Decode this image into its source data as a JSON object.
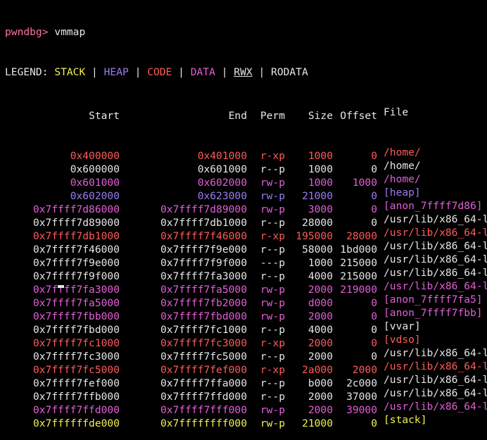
{
  "colors": {
    "prompt": "#ff6fa3",
    "default": "#e6e6e6",
    "stack": "#f0f050",
    "heap": "#9a7cf2",
    "code": "#ff5a5a",
    "data": "#e35fd7",
    "rodata": "#e6e6e6"
  },
  "prompt": {
    "label": "pwndbg>",
    "command": "vmmap"
  },
  "legend": {
    "prefix": "LEGEND:",
    "items": [
      {
        "label": "STACK",
        "kind": "stack",
        "underline": false
      },
      {
        "label": "HEAP",
        "kind": "heap",
        "underline": false
      },
      {
        "label": "CODE",
        "kind": "code",
        "underline": false
      },
      {
        "label": "DATA",
        "kind": "data",
        "underline": false
      },
      {
        "label": "RWX",
        "kind": "rodata",
        "underline": true
      },
      {
        "label": "RODATA",
        "kind": "rodata",
        "underline": false
      }
    ],
    "separator": "|"
  },
  "table": {
    "headers": {
      "start": "Start",
      "end": "End",
      "perm": "Perm",
      "size": "Size",
      "offset": "Offset",
      "file": "File"
    },
    "rows": [
      {
        "start": "0x400000",
        "end": "0x401000",
        "perm": "r-xp",
        "size": "1000",
        "offset": "0",
        "file": "/home/",
        "kind": "code"
      },
      {
        "start": "0x600000",
        "end": "0x601000",
        "perm": "r--p",
        "size": "1000",
        "offset": "0",
        "file": "/home/",
        "kind": "rodata"
      },
      {
        "start": "0x601000",
        "end": "0x602000",
        "perm": "rw-p",
        "size": "1000",
        "offset": "1000",
        "file": "/home/",
        "kind": "data"
      },
      {
        "start": "0x602000",
        "end": "0x623000",
        "perm": "rw-p",
        "size": "21000",
        "offset": "0",
        "file": "[heap]",
        "kind": "heap"
      },
      {
        "start": "0x7ffff7d86000",
        "end": "0x7ffff7d89000",
        "perm": "rw-p",
        "size": "3000",
        "offset": "0",
        "file": "[anon_7ffff7d86]",
        "kind": "data"
      },
      {
        "start": "0x7ffff7d89000",
        "end": "0x7ffff7db1000",
        "perm": "r--p",
        "size": "28000",
        "offset": "0",
        "file": "/usr/lib/x86_64-l",
        "kind": "rodata"
      },
      {
        "start": "0x7ffff7db1000",
        "end": "0x7ffff7f46000",
        "perm": "r-xp",
        "size": "195000",
        "offset": "28000",
        "file": "/usr/lib/x86_64-l",
        "kind": "code"
      },
      {
        "start": "0x7ffff7f46000",
        "end": "0x7ffff7f9e000",
        "perm": "r--p",
        "size": "58000",
        "offset": "1bd000",
        "file": "/usr/lib/x86_64-l",
        "kind": "rodata"
      },
      {
        "start": "0x7ffff7f9e000",
        "end": "0x7ffff7f9f000",
        "perm": "---p",
        "size": "1000",
        "offset": "215000",
        "file": "/usr/lib/x86_64-l",
        "kind": "rodata"
      },
      {
        "start": "0x7ffff7f9f000",
        "end": "0x7ffff7fa3000",
        "perm": "r--p",
        "size": "4000",
        "offset": "215000",
        "file": "/usr/lib/x86_64-l",
        "kind": "rodata"
      },
      {
        "start": "0x7ffff7fa3000",
        "end": "0x7ffff7fa5000",
        "perm": "rw-p",
        "size": "2000",
        "offset": "219000",
        "file": "/usr/lib/x86_64-l",
        "kind": "data"
      },
      {
        "start": "0x7ffff7fa5000",
        "end": "0x7ffff7fb2000",
        "perm": "rw-p",
        "size": "d000",
        "offset": "0",
        "file": "[anon_7ffff7fa5]",
        "kind": "data"
      },
      {
        "start": "0x7ffff7fbb000",
        "end": "0x7ffff7fbd000",
        "perm": "rw-p",
        "size": "2000",
        "offset": "0",
        "file": "[anon_7ffff7fbb]",
        "kind": "data"
      },
      {
        "start": "0x7ffff7fbd000",
        "end": "0x7ffff7fc1000",
        "perm": "r--p",
        "size": "4000",
        "offset": "0",
        "file": "[vvar]",
        "kind": "rodata"
      },
      {
        "start": "0x7ffff7fc1000",
        "end": "0x7ffff7fc3000",
        "perm": "r-xp",
        "size": "2000",
        "offset": "0",
        "file": "[vdso]",
        "kind": "code"
      },
      {
        "start": "0x7ffff7fc3000",
        "end": "0x7ffff7fc5000",
        "perm": "r--p",
        "size": "2000",
        "offset": "0",
        "file": "/usr/lib/x86_64-l",
        "kind": "rodata"
      },
      {
        "start": "0x7ffff7fc5000",
        "end": "0x7ffff7fef000",
        "perm": "r-xp",
        "size": "2a000",
        "offset": "2000",
        "file": "/usr/lib/x86_64-l",
        "kind": "code"
      },
      {
        "start": "0x7ffff7fef000",
        "end": "0x7ffff7ffa000",
        "perm": "r--p",
        "size": "b000",
        "offset": "2c000",
        "file": "/usr/lib/x86_64-l",
        "kind": "rodata"
      },
      {
        "start": "0x7ffff7ffb000",
        "end": "0x7ffff7ffd000",
        "perm": "r--p",
        "size": "2000",
        "offset": "37000",
        "file": "/usr/lib/x86_64-l",
        "kind": "rodata"
      },
      {
        "start": "0x7ffff7ffd000",
        "end": "0x7ffff7fff000",
        "perm": "rw-p",
        "size": "2000",
        "offset": "39000",
        "file": "/usr/lib/x86_64-l",
        "kind": "data"
      },
      {
        "start": "0x7ffffffde000",
        "end": "0x7ffffffff000",
        "perm": "rw-p",
        "size": "21000",
        "offset": "0",
        "file": "[stack]",
        "kind": "stack"
      }
    ]
  }
}
